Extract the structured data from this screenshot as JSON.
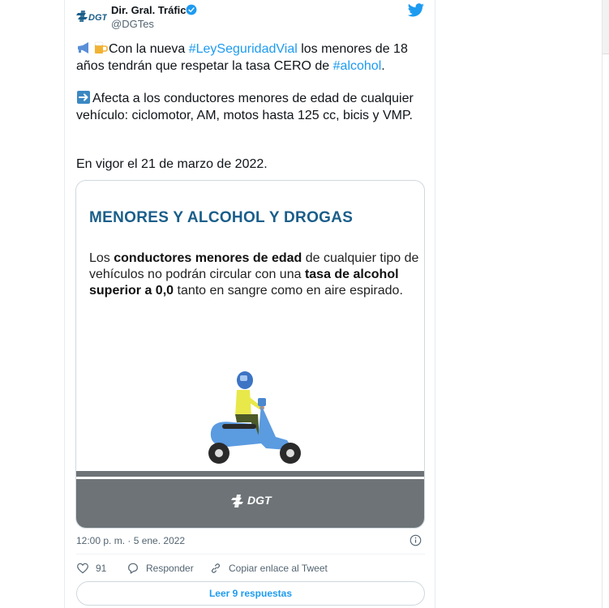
{
  "header": {
    "author_name": "Dir. Gral. Tráfico",
    "handle": "@DGTes"
  },
  "tweet": {
    "line1_a": "Con la nueva ",
    "line1_hashtag": "#LeySeguridadVial",
    "line1_b": " los menores de 18 años tendrán que respetar la tasa CERO de ",
    "line1_hashtag2": "#alcohol",
    "line1_c": ".",
    "para2": "Afecta a los conductores menores de edad de cualquier vehículo: ciclomotor, AM, motos hasta 125 cc, bicis y VMP.",
    "para3": "En vigor el 21 de marzo de 2022."
  },
  "card": {
    "title": "MENORES Y ALCOHOL Y DROGAS",
    "body_a": "Los ",
    "body_b": "conductores menores de edad",
    "body_c": " de cualquier tipo de vehículos no podrán circular con una ",
    "body_d": "tasa de alcohol superior a 0,0",
    "body_e": " tanto en sangre como en aire espirado.",
    "logo_text": "DGT"
  },
  "meta": {
    "timestamp": "12:00 p. m. · 5 ene. 2022"
  },
  "actions": {
    "like_count": "91",
    "reply_label": "Responder",
    "copy_label": "Copiar enlace al Tweet"
  },
  "footer": {
    "read_replies": "Leer 9 respuestas"
  },
  "colors": {
    "accent": "#1d9bf0",
    "card_title": "#1a5e8a",
    "road": "#6d7377"
  },
  "icons": [
    "dgt-logo-icon",
    "verified-badge-icon",
    "twitter-bird-icon",
    "megaphone-emoji-icon",
    "beer-emoji-icon",
    "arrow-right-emoji-icon",
    "info-icon",
    "heart-icon",
    "reply-icon",
    "link-icon"
  ]
}
